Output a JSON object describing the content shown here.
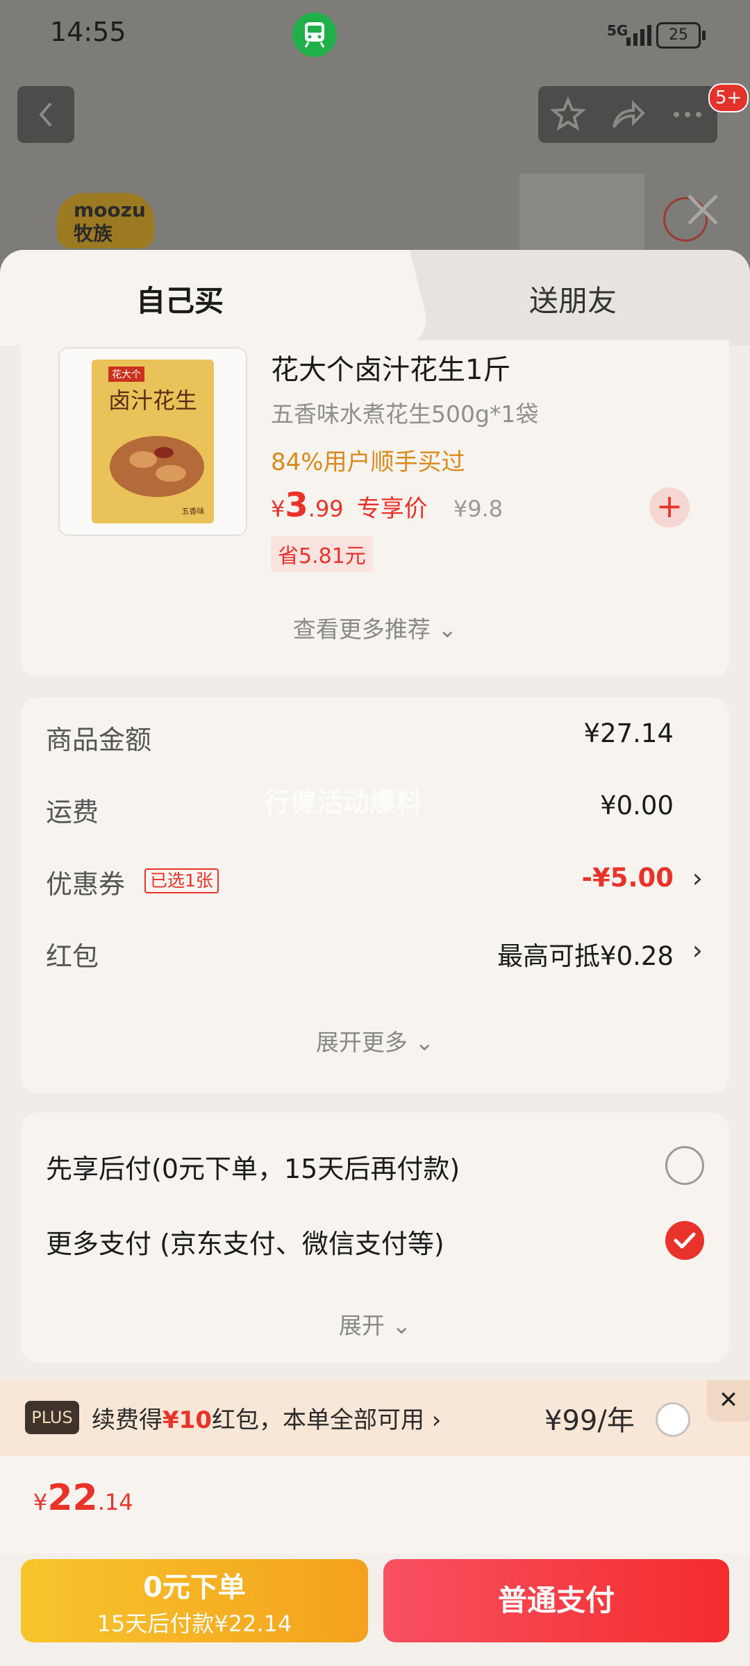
{
  "status_bar": {
    "time": "14:55",
    "network": "5G",
    "battery": "25"
  },
  "header": {
    "notification_badge": "5+"
  },
  "background_logo": {
    "brand": "moozu",
    "brand_cn": "牧族"
  },
  "tabs": [
    {
      "label": "自己买",
      "active": true
    },
    {
      "label": "送朋友",
      "active": false
    }
  ],
  "product": {
    "name": "花大个卤汁花生1斤",
    "spec": "五香味水煮花生500g*1袋",
    "repurchase": "84%用户顺手买过",
    "price_currency": "¥",
    "price_int": "3",
    "price_dec": ".99",
    "price_tag": "专享价",
    "original_price": "¥9.8",
    "save": "省5.81元",
    "package_brand": "花大个",
    "package_title": "卤汁花生",
    "package_flavor": "五香味",
    "more_recommend": "查看更多推荐"
  },
  "summary": {
    "watermark": "行健活动爆料",
    "rows": [
      {
        "label": "商品金额",
        "value": "¥27.14"
      },
      {
        "label": "运费",
        "value": "¥0.00"
      },
      {
        "label": "优惠券",
        "tag": "已选1张",
        "value": "-¥5.00"
      },
      {
        "label": "红包",
        "value": "最高可抵¥0.28"
      }
    ],
    "expand_more": "展开更多"
  },
  "payment": {
    "options": [
      {
        "label": "先享后付(0元下单，15天后再付款)",
        "selected": false
      },
      {
        "label": "更多支付 (京东支付、微信支付等)",
        "selected": true
      }
    ],
    "expand": "展开"
  },
  "plus": {
    "badge": "PLUS",
    "text_prefix": "续费得",
    "text_amount": "¥10",
    "text_suffix": "红包，本单全部可用",
    "price": "¥99/年"
  },
  "total": {
    "currency": "¥",
    "int": "22",
    "dec": ".14"
  },
  "buttons": {
    "pay_later_title": "0元下单",
    "pay_later_sub": "15天后付款¥22.14",
    "pay_now": "普通支付"
  },
  "colors": {
    "accent": "#e8322a",
    "pay_later": "#f7c52c",
    "pay_now": "#f42c2c"
  }
}
